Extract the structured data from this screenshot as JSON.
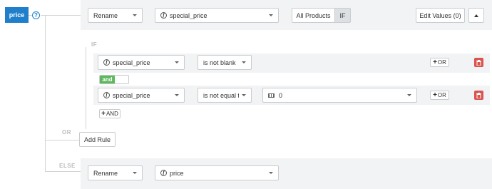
{
  "field": {
    "name": "price",
    "help_icon": "?"
  },
  "action_row": {
    "action_select": "Rename",
    "target_field": "special_price",
    "scope_toggle": [
      "All Products",
      "IF"
    ],
    "edit_values": "Edit Values (0)"
  },
  "if_block": {
    "label": "IF",
    "conditions": [
      {
        "field": "special_price",
        "operator": "is not blank",
        "value": null,
        "or_label": "OR"
      },
      {
        "field": "special_price",
        "operator": "is not equal to",
        "value": "0",
        "or_label": "OR"
      }
    ],
    "joiner": "and",
    "add_and_label": "AND"
  },
  "or_block": {
    "label": "OR",
    "add_rule": "Add Rule"
  },
  "else_block": {
    "label": "ELSE",
    "action_select": "Rename",
    "target_field": "price"
  },
  "colors": {
    "field_tag": "#1f7fcb",
    "and_toggle": "#5cb85c",
    "delete": "#d9534f"
  },
  "icons": [
    "help-icon",
    "fx-icon",
    "chevron-down-icon",
    "chevron-up-icon",
    "plus-icon",
    "trash-icon",
    "keyboard-icon"
  ]
}
